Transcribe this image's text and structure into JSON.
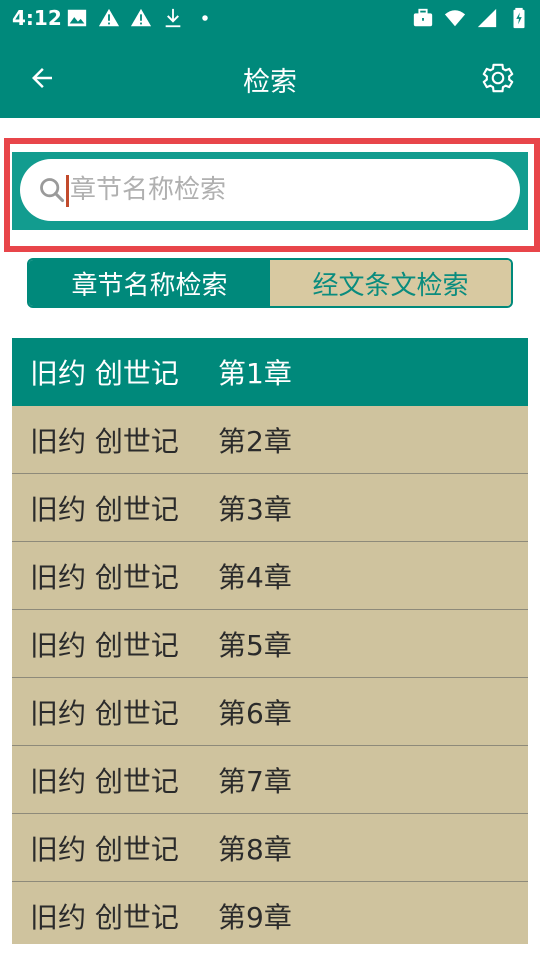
{
  "status_bar": {
    "time": "4:12"
  },
  "app_bar": {
    "title": "检索"
  },
  "search": {
    "placeholder": "章节名称检索",
    "value": ""
  },
  "mode_tabs": [
    {
      "label": "章节名称检索",
      "active": true
    },
    {
      "label": "经文条文检索",
      "active": false
    }
  ],
  "chapters": [
    {
      "book": "旧约 创世记",
      "chapter": "第1章",
      "selected": true
    },
    {
      "book": "旧约 创世记",
      "chapter": "第2章",
      "selected": false
    },
    {
      "book": "旧约 创世记",
      "chapter": "第3章",
      "selected": false
    },
    {
      "book": "旧约 创世记",
      "chapter": "第4章",
      "selected": false
    },
    {
      "book": "旧约 创世记",
      "chapter": "第5章",
      "selected": false
    },
    {
      "book": "旧约 创世记",
      "chapter": "第6章",
      "selected": false
    },
    {
      "book": "旧约 创世记",
      "chapter": "第7章",
      "selected": false
    },
    {
      "book": "旧约 创世记",
      "chapter": "第8章",
      "selected": false
    },
    {
      "book": "旧约 创世记",
      "chapter": "第9章",
      "selected": false
    }
  ],
  "colors": {
    "primary": "#00897b",
    "row_background": "#cfc39e",
    "highlight_border": "#e8454a"
  }
}
